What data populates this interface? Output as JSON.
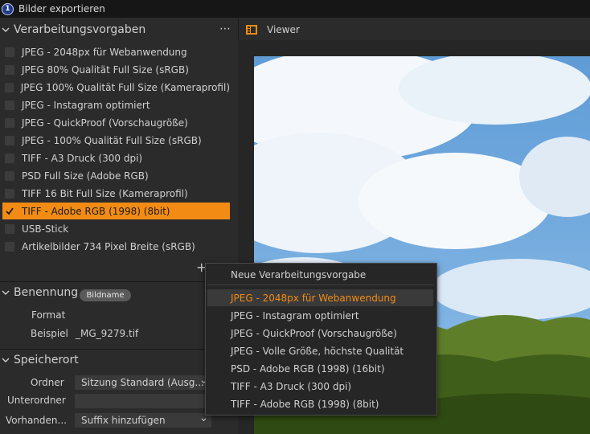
{
  "window": {
    "title": "Bilder exportieren",
    "icon_glyph": "1"
  },
  "colors": {
    "accent": "#f28b14",
    "panel": "#2b2b2b"
  },
  "processing": {
    "header": "Verarbeitungsvorgaben",
    "more_icon": "⋯",
    "add_icon": "+",
    "presets": [
      {
        "label": "JPEG - 2048px für Webanwendung",
        "checked": false
      },
      {
        "label": "JPEG 80% Qualität Full Size (sRGB)",
        "checked": false
      },
      {
        "label": "JPEG 100% Qualität Full Size (Kameraprofil)",
        "checked": false
      },
      {
        "label": "JPEG - Instagram optimiert",
        "checked": false
      },
      {
        "label": "JPEG - QuickProof (Vorschaugröße)",
        "checked": false
      },
      {
        "label": "JPEG - 100% Qualität Full Size (sRGB)",
        "checked": false
      },
      {
        "label": "TIFF - A3 Druck (300 dpi)",
        "checked": false
      },
      {
        "label": "PSD Full Size (Adobe RGB)",
        "checked": false
      },
      {
        "label": "TIFF 16 Bit Full Size (Kameraprofil)",
        "checked": false
      },
      {
        "label": "TIFF - Adobe RGB (1998) (8bit)",
        "checked": true
      },
      {
        "label": "USB-Stick",
        "checked": false
      },
      {
        "label": "Artikelbilder 734 Pixel Breite (sRGB)",
        "checked": false
      }
    ]
  },
  "naming": {
    "header": "Benennung",
    "format_label": "Format",
    "format_token": "Bildname",
    "example_label": "Beispiel",
    "example_value": "_MG_9279.tif"
  },
  "location": {
    "header": "Speicherort",
    "folder_label": "Ordner",
    "folder_value": "Sitzung Standard (Ausg...",
    "subfolder_label": "Unterordner",
    "subfolder_value": "",
    "existing_label": "Vorhanden...",
    "existing_value": "Suffix hinzufügen"
  },
  "viewer": {
    "title": "Viewer"
  },
  "context_menu": {
    "new_item": "Neue Verarbeitungsvorgabe",
    "items": [
      "JPEG - 2048px für Webanwendung",
      "JPEG - Instagram optimiert",
      "JPEG - QuickProof (Vorschaugröße)",
      "JPEG - Volle Größe, höchste Qualität",
      "PSD - Adobe RGB (1998) (16bit)",
      "TIFF - A3 Druck (300 dpi)",
      "TIFF - Adobe RGB (1998) (8bit)"
    ],
    "highlighted_index": 0
  }
}
